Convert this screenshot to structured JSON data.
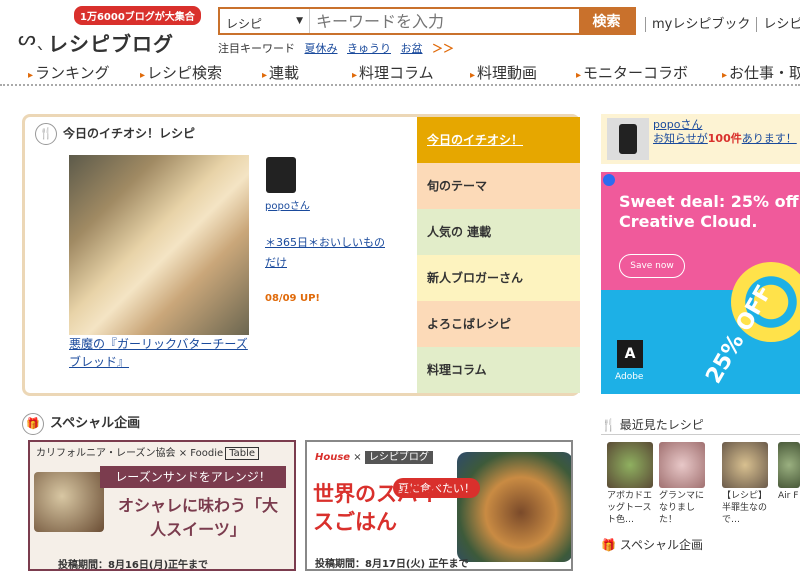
{
  "header": {
    "badge": "1万6000ブログが大集合",
    "logo_face": "ᔕˎ",
    "logo_text": "レシピブログ",
    "search": {
      "category": "レシピ",
      "placeholder": "キーワードを入力",
      "button": "検索"
    },
    "hot_keywords": {
      "label": "注目キーワード",
      "items": [
        "夏休み",
        "きゅうり",
        "お盆"
      ],
      "more": "＞＞"
    },
    "top_links": [
      "myレシピブック",
      "レシピを"
    ]
  },
  "nav": [
    "ランキング",
    "レシピ検索",
    "連載",
    "料理コラム",
    "料理動画",
    "モニターコラボ",
    "お仕事・取"
  ],
  "pickup": {
    "title": "今日のイチオシ！レシピ",
    "icon": "🍴",
    "recipe_title": "悪魔の『ガーリックバターチーズブレッド』",
    "author": "popoさん",
    "blog_name": "＊365日＊おいしいものだけ",
    "update": "08/09 UP!",
    "tabs": [
      "今日のイチオシ！",
      "旬のテーマ",
      "人気の 連載",
      "新人ブロガーさん",
      "よろこばレシピ",
      "料理コラム"
    ]
  },
  "special": {
    "title": "スペシャル企画",
    "banner1": {
      "org": "カリフォルニア・レーズン協会",
      "x": "×",
      "partner": "Foodie",
      "partner_tag": "Table",
      "strip": "レーズンサンドをアレンジ！",
      "main": "オシャレに味わう「大人スイーツ」",
      "period": "投稿期間：8月16日(月)正午まで"
    },
    "banner2": {
      "brand": "House",
      "x": "×",
      "partner": "レシピブログ",
      "sub": "夏に食べたい！",
      "main": "世界のスパイスごはん",
      "period": "投稿期間：8月17日(火) 正午まで"
    }
  },
  "right": {
    "notice_name": "popoさん",
    "notice_prefix": "お知らせが",
    "notice_count": "100件",
    "notice_suffix": "あります！",
    "ad": {
      "title": "Sweet deal: 25% off Creative Cloud.",
      "button": "Save now",
      "logo": "A",
      "brand": "Adobe",
      "off": "25% OFF"
    },
    "recent_title": "最近見たレシピ",
    "recent": [
      {
        "label": "アボカドエッグトースト色…"
      },
      {
        "label": "グランマになりました！"
      },
      {
        "label": "【レシピ】半罪生なので…"
      },
      {
        "label": "Air F"
      }
    ],
    "special_title": "スペシャル企画"
  },
  "colors": {
    "accent": "#c9712c",
    "tab_active": "#e6a700",
    "nav_arrow": "#e06a0a"
  }
}
